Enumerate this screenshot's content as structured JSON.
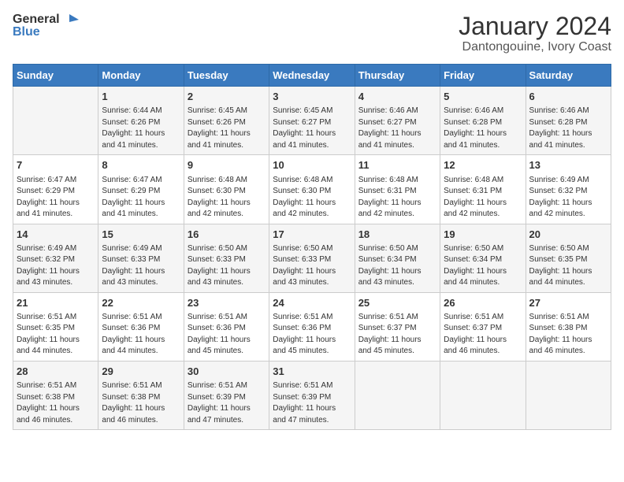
{
  "header": {
    "logo_line1": "General",
    "logo_line2": "Blue",
    "title": "January 2024",
    "subtitle": "Dantongouine, Ivory Coast"
  },
  "days_of_week": [
    "Sunday",
    "Monday",
    "Tuesday",
    "Wednesday",
    "Thursday",
    "Friday",
    "Saturday"
  ],
  "weeks": [
    [
      {
        "day": "",
        "lines": []
      },
      {
        "day": "1",
        "lines": [
          "Sunrise: 6:44 AM",
          "Sunset: 6:26 PM",
          "Daylight: 11 hours",
          "and 41 minutes."
        ]
      },
      {
        "day": "2",
        "lines": [
          "Sunrise: 6:45 AM",
          "Sunset: 6:26 PM",
          "Daylight: 11 hours",
          "and 41 minutes."
        ]
      },
      {
        "day": "3",
        "lines": [
          "Sunrise: 6:45 AM",
          "Sunset: 6:27 PM",
          "Daylight: 11 hours",
          "and 41 minutes."
        ]
      },
      {
        "day": "4",
        "lines": [
          "Sunrise: 6:46 AM",
          "Sunset: 6:27 PM",
          "Daylight: 11 hours",
          "and 41 minutes."
        ]
      },
      {
        "day": "5",
        "lines": [
          "Sunrise: 6:46 AM",
          "Sunset: 6:28 PM",
          "Daylight: 11 hours",
          "and 41 minutes."
        ]
      },
      {
        "day": "6",
        "lines": [
          "Sunrise: 6:46 AM",
          "Sunset: 6:28 PM",
          "Daylight: 11 hours",
          "and 41 minutes."
        ]
      }
    ],
    [
      {
        "day": "7",
        "lines": [
          "Sunrise: 6:47 AM",
          "Sunset: 6:29 PM",
          "Daylight: 11 hours",
          "and 41 minutes."
        ]
      },
      {
        "day": "8",
        "lines": [
          "Sunrise: 6:47 AM",
          "Sunset: 6:29 PM",
          "Daylight: 11 hours",
          "and 41 minutes."
        ]
      },
      {
        "day": "9",
        "lines": [
          "Sunrise: 6:48 AM",
          "Sunset: 6:30 PM",
          "Daylight: 11 hours",
          "and 42 minutes."
        ]
      },
      {
        "day": "10",
        "lines": [
          "Sunrise: 6:48 AM",
          "Sunset: 6:30 PM",
          "Daylight: 11 hours",
          "and 42 minutes."
        ]
      },
      {
        "day": "11",
        "lines": [
          "Sunrise: 6:48 AM",
          "Sunset: 6:31 PM",
          "Daylight: 11 hours",
          "and 42 minutes."
        ]
      },
      {
        "day": "12",
        "lines": [
          "Sunrise: 6:48 AM",
          "Sunset: 6:31 PM",
          "Daylight: 11 hours",
          "and 42 minutes."
        ]
      },
      {
        "day": "13",
        "lines": [
          "Sunrise: 6:49 AM",
          "Sunset: 6:32 PM",
          "Daylight: 11 hours",
          "and 42 minutes."
        ]
      }
    ],
    [
      {
        "day": "14",
        "lines": [
          "Sunrise: 6:49 AM",
          "Sunset: 6:32 PM",
          "Daylight: 11 hours",
          "and 43 minutes."
        ]
      },
      {
        "day": "15",
        "lines": [
          "Sunrise: 6:49 AM",
          "Sunset: 6:33 PM",
          "Daylight: 11 hours",
          "and 43 minutes."
        ]
      },
      {
        "day": "16",
        "lines": [
          "Sunrise: 6:50 AM",
          "Sunset: 6:33 PM",
          "Daylight: 11 hours",
          "and 43 minutes."
        ]
      },
      {
        "day": "17",
        "lines": [
          "Sunrise: 6:50 AM",
          "Sunset: 6:33 PM",
          "Daylight: 11 hours",
          "and 43 minutes."
        ]
      },
      {
        "day": "18",
        "lines": [
          "Sunrise: 6:50 AM",
          "Sunset: 6:34 PM",
          "Daylight: 11 hours",
          "and 43 minutes."
        ]
      },
      {
        "day": "19",
        "lines": [
          "Sunrise: 6:50 AM",
          "Sunset: 6:34 PM",
          "Daylight: 11 hours",
          "and 44 minutes."
        ]
      },
      {
        "day": "20",
        "lines": [
          "Sunrise: 6:50 AM",
          "Sunset: 6:35 PM",
          "Daylight: 11 hours",
          "and 44 minutes."
        ]
      }
    ],
    [
      {
        "day": "21",
        "lines": [
          "Sunrise: 6:51 AM",
          "Sunset: 6:35 PM",
          "Daylight: 11 hours",
          "and 44 minutes."
        ]
      },
      {
        "day": "22",
        "lines": [
          "Sunrise: 6:51 AM",
          "Sunset: 6:36 PM",
          "Daylight: 11 hours",
          "and 44 minutes."
        ]
      },
      {
        "day": "23",
        "lines": [
          "Sunrise: 6:51 AM",
          "Sunset: 6:36 PM",
          "Daylight: 11 hours",
          "and 45 minutes."
        ]
      },
      {
        "day": "24",
        "lines": [
          "Sunrise: 6:51 AM",
          "Sunset: 6:36 PM",
          "Daylight: 11 hours",
          "and 45 minutes."
        ]
      },
      {
        "day": "25",
        "lines": [
          "Sunrise: 6:51 AM",
          "Sunset: 6:37 PM",
          "Daylight: 11 hours",
          "and 45 minutes."
        ]
      },
      {
        "day": "26",
        "lines": [
          "Sunrise: 6:51 AM",
          "Sunset: 6:37 PM",
          "Daylight: 11 hours",
          "and 46 minutes."
        ]
      },
      {
        "day": "27",
        "lines": [
          "Sunrise: 6:51 AM",
          "Sunset: 6:38 PM",
          "Daylight: 11 hours",
          "and 46 minutes."
        ]
      }
    ],
    [
      {
        "day": "28",
        "lines": [
          "Sunrise: 6:51 AM",
          "Sunset: 6:38 PM",
          "Daylight: 11 hours",
          "and 46 minutes."
        ]
      },
      {
        "day": "29",
        "lines": [
          "Sunrise: 6:51 AM",
          "Sunset: 6:38 PM",
          "Daylight: 11 hours",
          "and 46 minutes."
        ]
      },
      {
        "day": "30",
        "lines": [
          "Sunrise: 6:51 AM",
          "Sunset: 6:39 PM",
          "Daylight: 11 hours",
          "and 47 minutes."
        ]
      },
      {
        "day": "31",
        "lines": [
          "Sunrise: 6:51 AM",
          "Sunset: 6:39 PM",
          "Daylight: 11 hours",
          "and 47 minutes."
        ]
      },
      {
        "day": "",
        "lines": []
      },
      {
        "day": "",
        "lines": []
      },
      {
        "day": "",
        "lines": []
      }
    ]
  ]
}
